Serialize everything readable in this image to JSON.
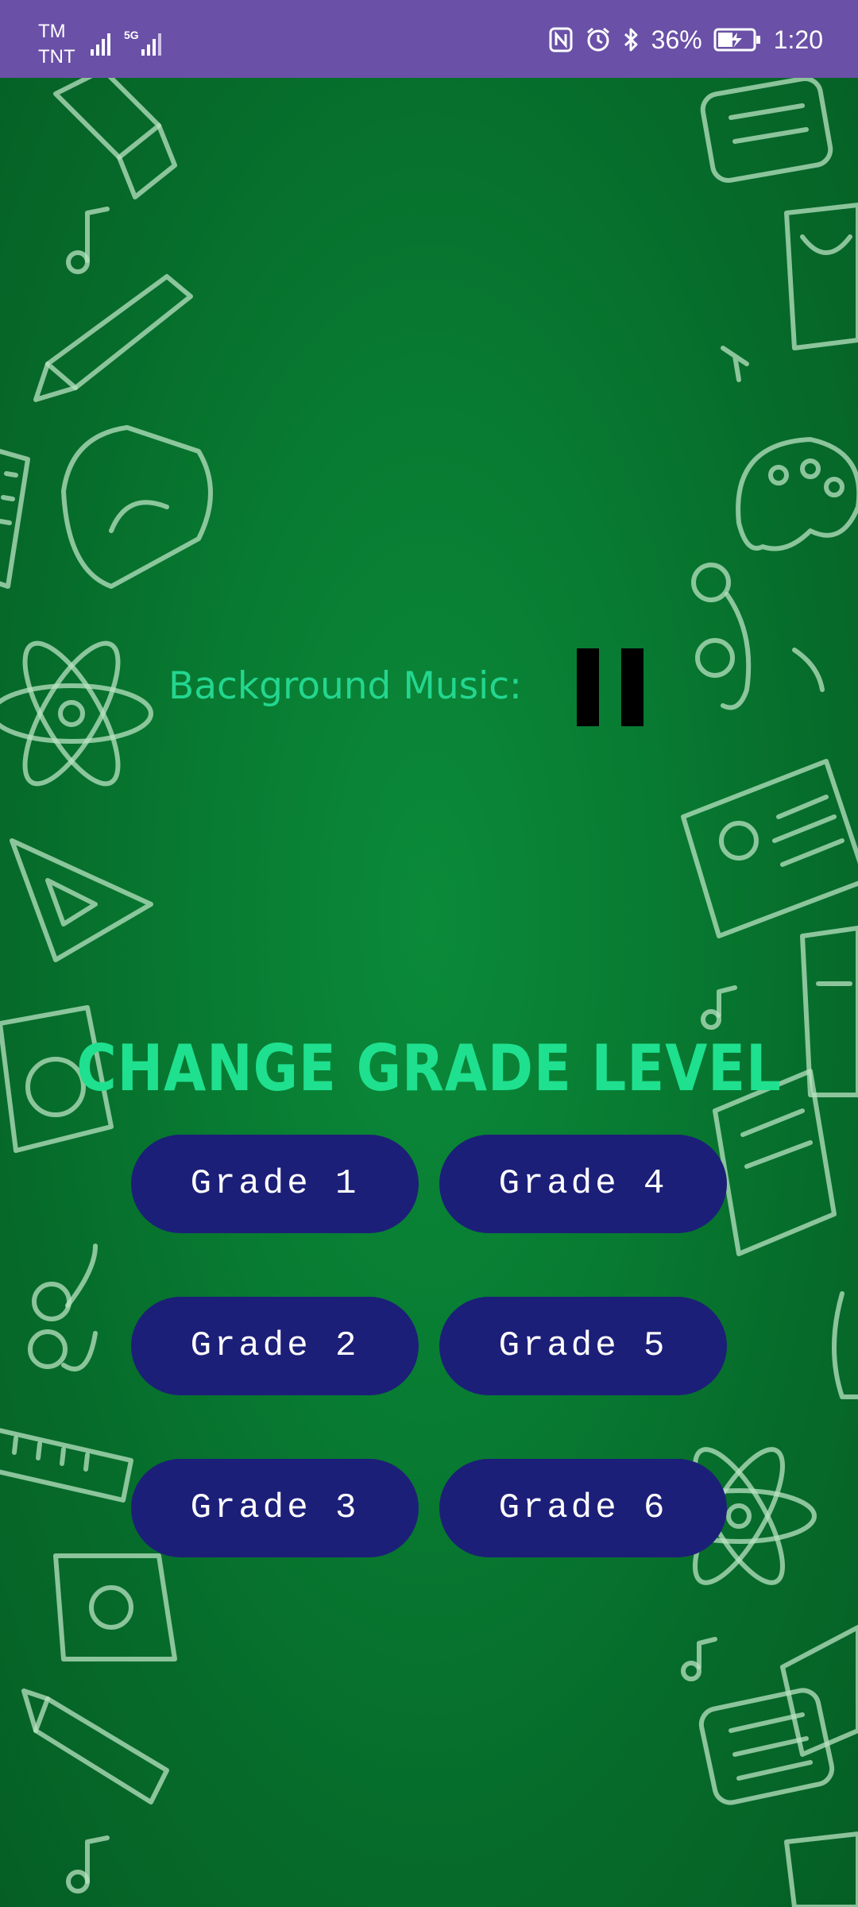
{
  "status_bar": {
    "carrier_1": "TM",
    "carrier_2": "TNT",
    "network_type": "5G",
    "battery_percent": "36%",
    "time": "1:20",
    "icons": [
      "signal-icon",
      "signal-5g-icon",
      "nfc-icon",
      "alarm-icon",
      "bluetooth-icon",
      "battery-charging-icon"
    ]
  },
  "music": {
    "label": "Background Music:",
    "toggle_icon": "pause-icon"
  },
  "grade_section": {
    "heading": "CHANGE GRADE LEVEL",
    "buttons": [
      {
        "label": "Grade 1"
      },
      {
        "label": "Grade 2"
      },
      {
        "label": "Grade 3"
      },
      {
        "label": "Grade 4"
      },
      {
        "label": "Grade 5"
      },
      {
        "label": "Grade 6"
      }
    ]
  },
  "colors": {
    "status_bar": "#6a50a7",
    "background": "#087c32",
    "accent_text": "#24d68f",
    "button": "#1c1f78",
    "button_text": "#ffffff"
  }
}
